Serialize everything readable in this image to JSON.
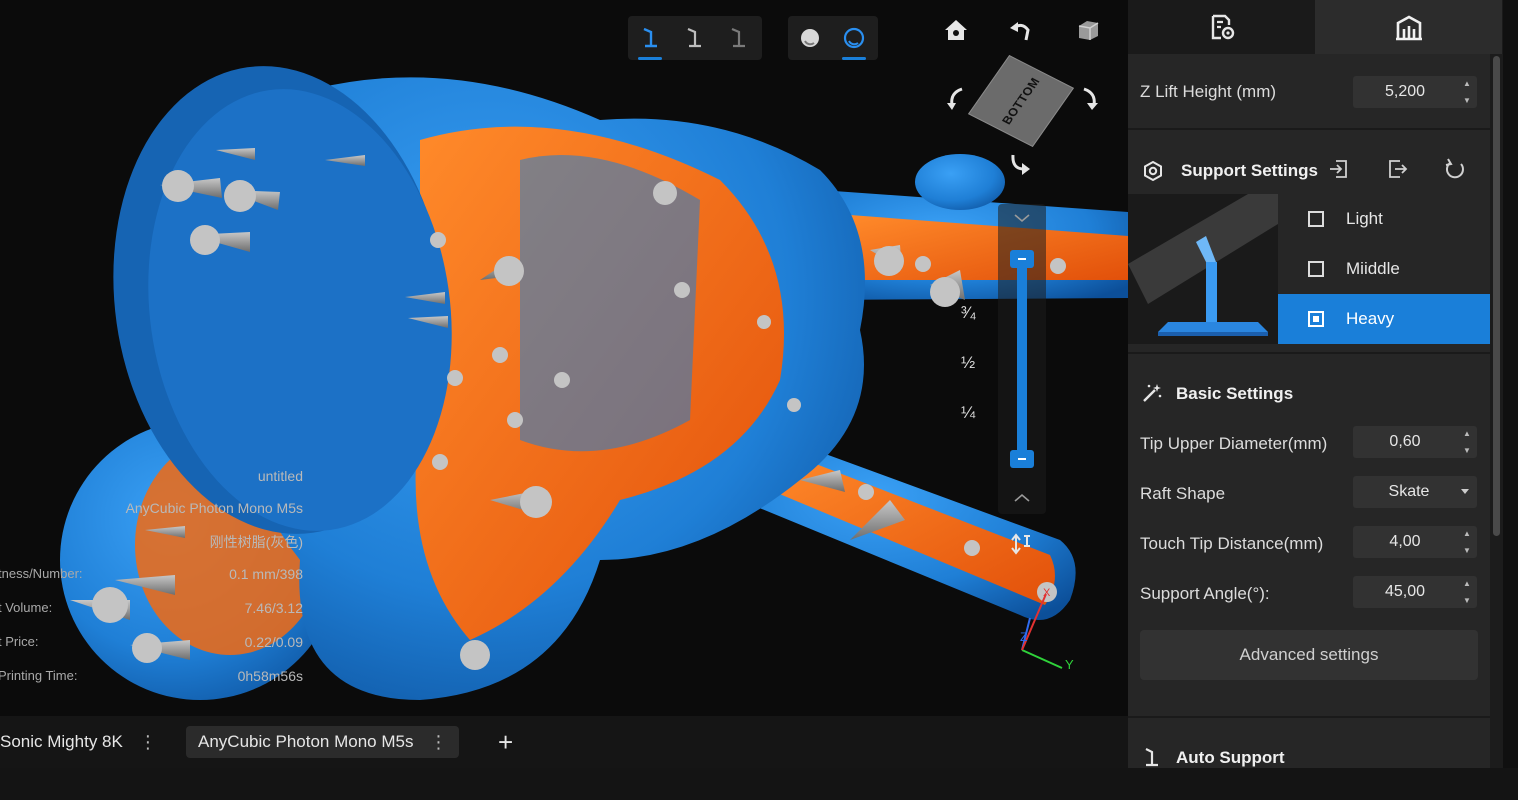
{
  "viewport": {
    "view_cube_face": "BOTTOM",
    "view_toolbar_left": [
      "support-view-1-icon",
      "support-view-2-icon",
      "support-view-3-icon"
    ],
    "view_toolbar_right": [
      "solid-shading-icon",
      "xray-shading-icon"
    ],
    "nav_icons": [
      "home-icon",
      "undo-icon",
      "cube-icon",
      "rotate-left-icon",
      "rotate-right-icon",
      "rotate-down-icon"
    ],
    "z_slider": {
      "fractions": [
        "³⁄₄",
        "½",
        "¼"
      ],
      "lower_level": 0,
      "upper_level": 1
    },
    "axes": {
      "x": "X",
      "y": "Y",
      "z": "Z"
    }
  },
  "info": {
    "filename": "untitled",
    "printer": "AnyCubic Photon Mono M5s",
    "resin": "刚性树脂(灰色)",
    "rows": [
      {
        "label": "tness/Number:",
        "value": "0.1 mm/398"
      },
      {
        "label": "t Volume:",
        "value": "7.46/3.12"
      },
      {
        "label": "t Price:",
        "value": "0.22/0.09"
      },
      {
        "label": "Printing Time:",
        "value": "0h58m56s"
      }
    ]
  },
  "printer_tabs": [
    {
      "label": "Sonic Mighty 8K",
      "menu": "⋮",
      "active": false
    },
    {
      "label": "AnyCubic Photon Mono M5s",
      "menu": "⋮",
      "active": true
    }
  ],
  "add_tab_label": "+",
  "panel": {
    "tabs": [
      "slice-settings-icon",
      "support-icon"
    ],
    "z_lift": {
      "label": "Z Lift Height (mm)",
      "value": "5,200"
    },
    "support_settings": {
      "title": "Support Settings",
      "options": [
        {
          "label": "Light",
          "selected": false
        },
        {
          "label": "Miiddle",
          "selected": false
        },
        {
          "label": "Heavy",
          "selected": true
        }
      ]
    },
    "basic_settings": {
      "title": "Basic Settings",
      "fields": [
        {
          "label": "Tip Upper Diameter(mm)",
          "value": "0,60",
          "type": "spin"
        },
        {
          "label": "Raft Shape",
          "value": "Skate",
          "type": "select"
        },
        {
          "label": "Touch Tip Distance(mm)",
          "value": "4,00",
          "type": "spin"
        },
        {
          "label": "Support Angle(°):",
          "value": "45,00",
          "type": "spin"
        }
      ],
      "advanced_label": "Advanced settings"
    },
    "auto_support": {
      "title": "Auto Support"
    }
  },
  "colors": {
    "accent": "#1a7fd9",
    "model_blue": "#1f7fd6",
    "overhang_orange": "#f26a12",
    "support_grey": "#a0a0a0"
  }
}
